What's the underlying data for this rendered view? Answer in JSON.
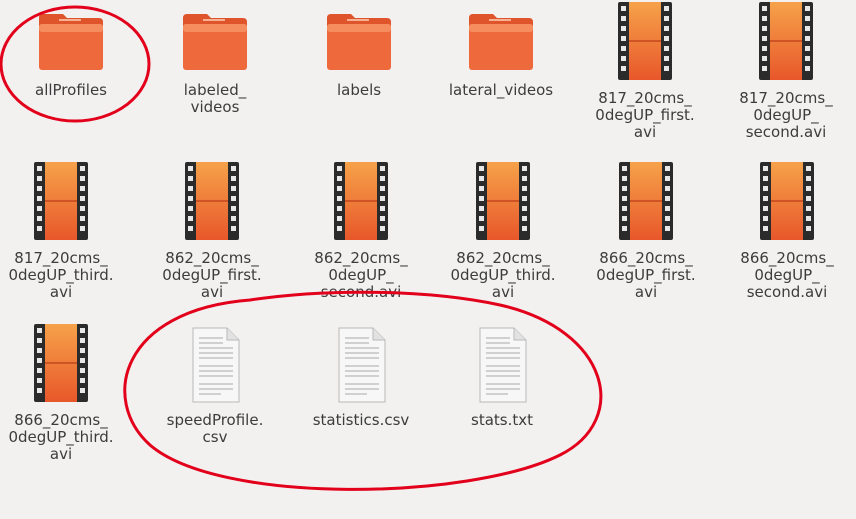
{
  "files": [
    {
      "name": "allProfiles",
      "type": "folder",
      "icon": "folder-icon"
    },
    {
      "name": "labeled_\nvideos",
      "type": "folder",
      "icon": "folder-icon"
    },
    {
      "name": "labels",
      "type": "folder",
      "icon": "folder-icon"
    },
    {
      "name": "lateral_videos",
      "type": "folder",
      "icon": "folder-icon"
    },
    {
      "name": "817_20cms_\n0degUP_first.\navi",
      "type": "video",
      "icon": "video-file-icon"
    },
    {
      "name": "817_20cms_\n0degUP_\nsecond.avi",
      "type": "video",
      "icon": "video-file-icon"
    },
    {
      "name": "817_20cms_\n0degUP_third.\navi",
      "type": "video",
      "icon": "video-file-icon"
    },
    {
      "name": "862_20cms_\n0degUP_first.\navi",
      "type": "video",
      "icon": "video-file-icon"
    },
    {
      "name": "862_20cms_\n0degUP_\nsecond.avi",
      "type": "video",
      "icon": "video-file-icon"
    },
    {
      "name": "862_20cms_\n0degUP_third.\navi",
      "type": "video",
      "icon": "video-file-icon"
    },
    {
      "name": "866_20cms_\n0degUP_first.\navi",
      "type": "video",
      "icon": "video-file-icon"
    },
    {
      "name": "866_20cms_\n0degUP_\nsecond.avi",
      "type": "video",
      "icon": "video-file-icon"
    },
    {
      "name": "866_20cms_\n0degUP_third.\navi",
      "type": "video",
      "icon": "video-file-icon"
    },
    {
      "name": "speedProfile.\ncsv",
      "type": "text",
      "icon": "text-file-icon"
    },
    {
      "name": "statistics.csv",
      "type": "text",
      "icon": "text-file-icon"
    },
    {
      "name": "stats.txt",
      "type": "text",
      "icon": "text-file-icon"
    }
  ],
  "colors": {
    "background": "#f2f1f0",
    "folder_body": "#ee6a3c",
    "folder_tab": "#e0542b",
    "video_top": "#f6a24a",
    "video_bottom": "#e8572a",
    "annotation": "#e3001b"
  }
}
